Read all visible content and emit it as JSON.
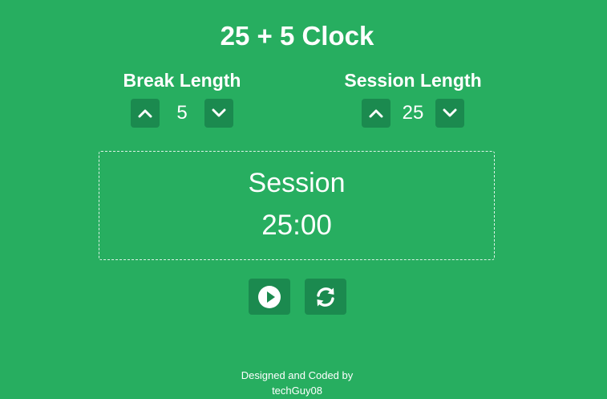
{
  "title": "25 + 5 Clock",
  "break": {
    "label": "Break Length",
    "value": "5",
    "increment_icon": "chevron-up-icon",
    "decrement_icon": "chevron-down-icon"
  },
  "session": {
    "label": "Session Length",
    "value": "25",
    "increment_icon": "chevron-up-icon",
    "decrement_icon": "chevron-down-icon"
  },
  "timer": {
    "label": "Session",
    "time": "25:00"
  },
  "actions": {
    "play_icon": "play-icon",
    "reset_icon": "refresh-icon"
  },
  "footer": {
    "line1": "Designed and Coded by",
    "line2": "techGuy08"
  },
  "colors": {
    "background": "#27ae60",
    "button": "#1b8a4f",
    "text": "#ffffff"
  }
}
